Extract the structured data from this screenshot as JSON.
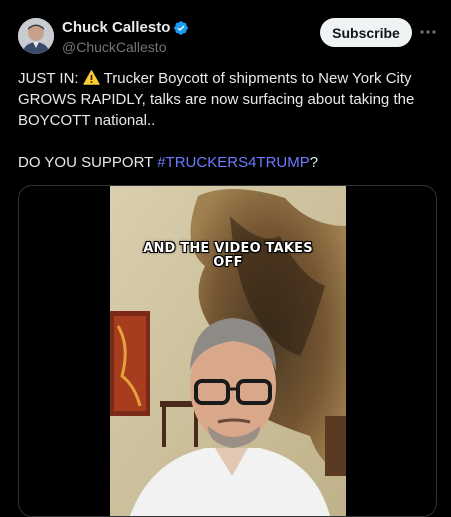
{
  "author": {
    "name": "Chuck Callesto",
    "handle": "@ChuckCallesto",
    "verified": true
  },
  "actions": {
    "subscribe_label": "Subscribe",
    "more_icon": "more-dots-icon"
  },
  "tweet": {
    "prefix": "JUST IN: ",
    "warning_icon": "warning-icon",
    "line1_rest": " Trucker Boycott of shipments to New York City GROWS RAPIDLY, talks are now surfacing about taking the BOYCOTT national..",
    "question_prefix": "DO YOU SUPPORT ",
    "hashtag": "#TRUCKERS4TRUMP",
    "question_suffix": "?"
  },
  "media": {
    "caption": "AND THE VIDEO TAKES OFF"
  },
  "colors": {
    "background": "#000000",
    "text": "#e7e9ea",
    "secondary": "#71767b",
    "hashtag": "#6c7bff",
    "verified": "#1d9bf0"
  }
}
